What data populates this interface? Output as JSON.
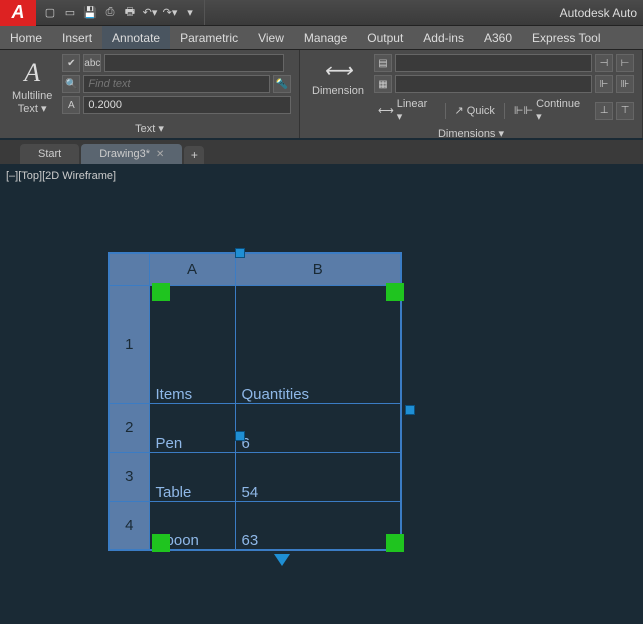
{
  "title": "Autodesk Auto",
  "menu": {
    "home": "Home",
    "insert": "Insert",
    "annotate": "Annotate",
    "parametric": "Parametric",
    "view": "View",
    "manage": "Manage",
    "output": "Output",
    "addins": "Add-ins",
    "a360": "A360",
    "express": "Express Tool"
  },
  "ribbon": {
    "text_panel": {
      "multiline_label": "Multiline\nText",
      "find_placeholder": "Find text",
      "height_value": "0.2000",
      "panel_name": "Text ▾"
    },
    "dim_panel": {
      "dimension_label": "Dimension",
      "linear": "Linear ▾",
      "quick": "Quick",
      "continue": "Continue ▾",
      "panel_name": "Dimensions ▾"
    }
  },
  "tabs": {
    "start": "Start",
    "drawing": "Drawing3*"
  },
  "viewcube": "[–][Top][2D Wireframe]",
  "chart_data": {
    "type": "table",
    "columns": [
      "A",
      "B"
    ],
    "rows": [
      "1",
      "2",
      "3",
      "4"
    ],
    "cells": {
      "A1": "Items",
      "B1": "Quantities",
      "A2": "Pen",
      "B2": "6",
      "A3": "Table",
      "B3": "54",
      "A4": "Spoon",
      "B4": "63"
    }
  }
}
